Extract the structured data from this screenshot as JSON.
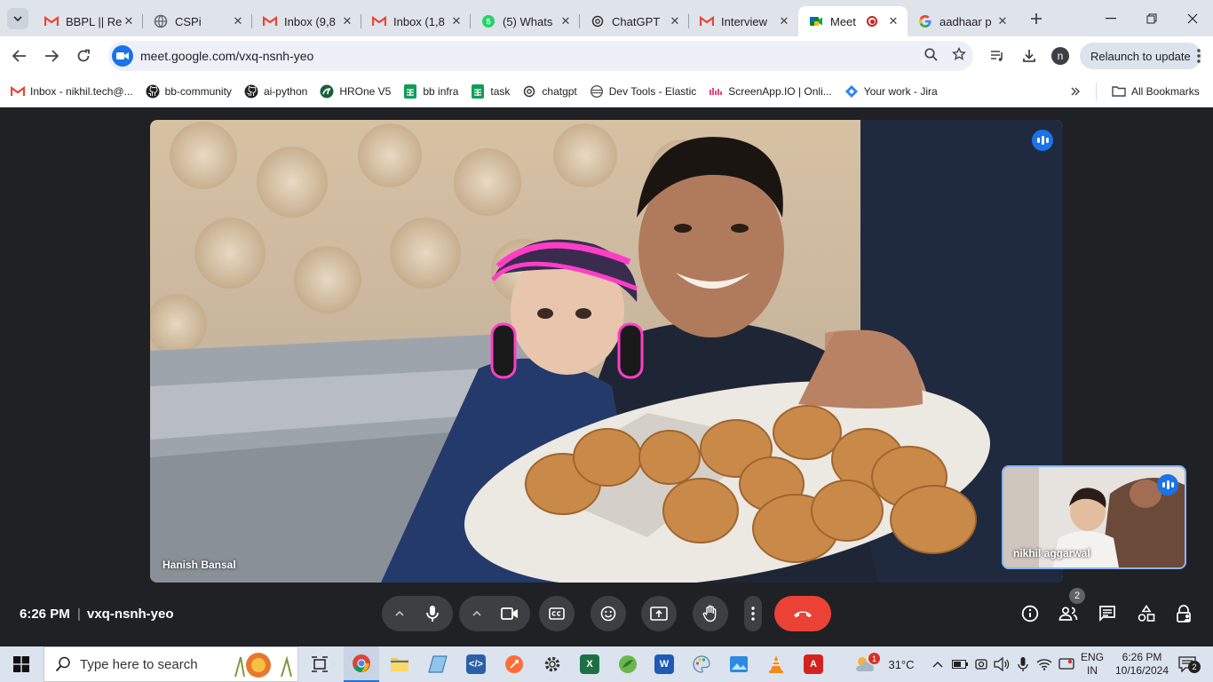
{
  "browser": {
    "tabs": [
      {
        "title": "BBPL || Re",
        "icon": "gmail-icon",
        "active": false
      },
      {
        "title": "CSPi",
        "icon": "globe-icon",
        "active": false
      },
      {
        "title": "Inbox (9,8",
        "icon": "gmail-icon",
        "active": false
      },
      {
        "title": "Inbox (1,8",
        "icon": "gmail-icon",
        "active": false
      },
      {
        "title": "(5) Whats",
        "icon": "whatsapp-icon",
        "active": false
      },
      {
        "title": "ChatGPT",
        "icon": "chatgpt-icon",
        "active": false
      },
      {
        "title": "Interview",
        "icon": "gmail-icon",
        "active": false
      },
      {
        "title": "Meet",
        "icon": "meet-icon",
        "active": true
      },
      {
        "title": "aadhaar p",
        "icon": "google-icon",
        "active": false
      }
    ],
    "url": "meet.google.com/vxq-nsnh-yeo",
    "profile_initial": "n",
    "relaunch_label": "Relaunch to update",
    "bookmarks": [
      {
        "label": "Inbox - nikhil.tech@...",
        "icon": "gmail-icon"
      },
      {
        "label": "bb-community",
        "icon": "github-icon"
      },
      {
        "label": "ai-python",
        "icon": "github-icon"
      },
      {
        "label": "HROne V5",
        "icon": "hrone-icon"
      },
      {
        "label": "bb infra",
        "icon": "sheets-icon"
      },
      {
        "label": "task",
        "icon": "sheets-icon"
      },
      {
        "label": "chatgpt",
        "icon": "chatgpt-icon"
      },
      {
        "label": "Dev Tools - Elastic",
        "icon": "elastic-icon"
      },
      {
        "label": "ScreenApp.IO | Onli...",
        "icon": "screenapp-icon"
      },
      {
        "label": "Your work - Jira",
        "icon": "jira-icon"
      }
    ],
    "all_bookmarks_label": "All Bookmarks"
  },
  "meet": {
    "main_participant": "Hanish Bansal",
    "self_participant": "nikhil aggarwal",
    "time": "6:26 PM",
    "separator": "|",
    "meeting_code": "vxq-nsnh-yeo",
    "participants_count": "2"
  },
  "taskbar": {
    "search_placeholder": "Type here to search",
    "weather_temp": "31°C",
    "weather_badge": "1",
    "lang_line1": "ENG",
    "lang_line2": "IN",
    "clock_time": "6:26 PM",
    "clock_date": "10/16/2024",
    "notification_count": "2"
  },
  "colors": {
    "meet_bg": "#202124",
    "end_call": "#ea4335",
    "accent_blue": "#1a73e8",
    "tab_strip": "#dfe3ea"
  }
}
